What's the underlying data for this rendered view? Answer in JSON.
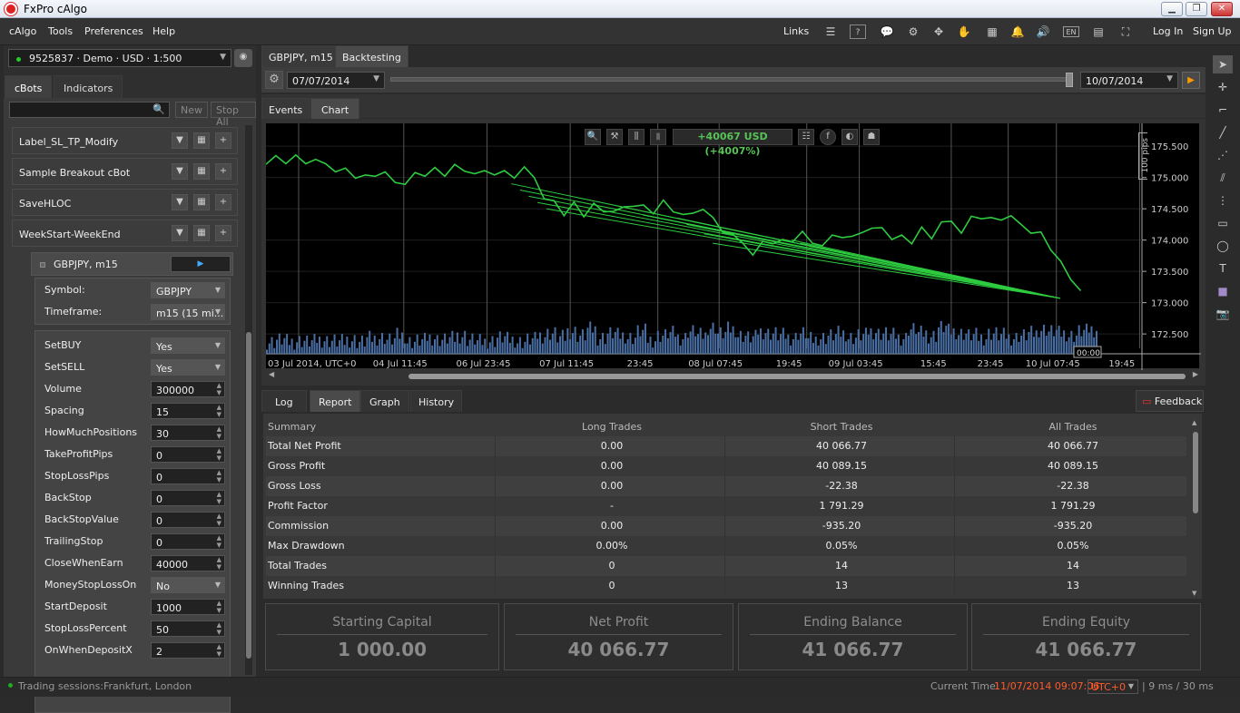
{
  "window": {
    "title": "FxPro cAlgo",
    "buttons": [
      "▁",
      "❐",
      "✕"
    ]
  },
  "menu": {
    "items": [
      "cAlgo",
      "Tools",
      "Preferences",
      "Help"
    ],
    "right": {
      "links": "Links",
      "login": "Log In",
      "signup": "Sign Up"
    },
    "icons": [
      "document-icon",
      "keyboard-shortcuts-icon",
      "chat-icon",
      "hub-icon",
      "settings-icon",
      "hand-check-icon",
      "calendar-icon",
      "bell-icon",
      "sound-icon",
      "language-icon",
      "layout-icon",
      "fullscreen-icon"
    ],
    "icon_glyphs": [
      "☰",
      "?",
      "💬",
      "⚙",
      "✥",
      "✋",
      "▦",
      "🔔",
      "🔊",
      "EN",
      "▤",
      "⛶"
    ]
  },
  "account": {
    "label": "9525837 · Demo · USD · 1:500",
    "status_color": "#22cc22"
  },
  "left_tabs": {
    "cbots": "cBots",
    "indicators": "Indicators"
  },
  "left_search": {
    "placeholder": "",
    "new": "New",
    "stop_all": "Stop All"
  },
  "bots": [
    {
      "name": "Label_SL_TP_Modify"
    },
    {
      "name": "Sample Breakout cBot"
    },
    {
      "name": "SaveHLOC"
    },
    {
      "name": "WeekStart-WeekEnd"
    }
  ],
  "instance": {
    "label": "GBPJPY, m15",
    "symbol": {
      "label": "Symbol:",
      "value": "GBPJPY"
    },
    "timeframe": {
      "label": "Timeframe:",
      "value": "m15 (15 mi..."
    },
    "params": [
      {
        "label": "SetBUY",
        "value": "Yes",
        "kind": "select"
      },
      {
        "label": "SetSELL",
        "value": "Yes",
        "kind": "select"
      },
      {
        "label": "Volume",
        "value": "300000",
        "kind": "num"
      },
      {
        "label": "Spacing",
        "value": "15",
        "kind": "num"
      },
      {
        "label": "HowMuchPositions",
        "value": "30",
        "kind": "num"
      },
      {
        "label": "TakeProfitPips",
        "value": "0",
        "kind": "num"
      },
      {
        "label": "StopLossPips",
        "value": "0",
        "kind": "num"
      },
      {
        "label": "BackStop",
        "value": "0",
        "kind": "num"
      },
      {
        "label": "BackStopValue",
        "value": "0",
        "kind": "num"
      },
      {
        "label": "TrailingStop",
        "value": "0",
        "kind": "num"
      },
      {
        "label": "CloseWhenEarn",
        "value": "40000",
        "kind": "num"
      },
      {
        "label": "MoneyStopLossOn",
        "value": "No",
        "kind": "select"
      },
      {
        "label": "StartDeposit",
        "value": "1000",
        "kind": "num"
      },
      {
        "label": "StopLossPercent",
        "value": "50",
        "kind": "num"
      },
      {
        "label": "OnWhenDepositX",
        "value": "2",
        "kind": "num"
      }
    ]
  },
  "center_tabs": {
    "symbol": "GBPJPY, m15",
    "backtesting": "Backtesting"
  },
  "backtest": {
    "from": "07/07/2014",
    "to": "10/07/2014"
  },
  "view_tabs": {
    "events": "Events",
    "chart": "Chart"
  },
  "chart_toolbar": {
    "profit": "+40067 USD (+4007%)"
  },
  "chart_data": {
    "type": "line",
    "symbol": "GBPJPY",
    "timeframe": "m15",
    "title": "",
    "ylabel": "",
    "pips_label": "100 pips",
    "y_ticks": [
      "175.500",
      "175.000",
      "174.500",
      "174.000",
      "173.500",
      "173.000",
      "172.500"
    ],
    "y_values": [
      175.5,
      175.0,
      174.5,
      174.0,
      173.5,
      173.0,
      172.5
    ],
    "ylim": [
      172.27,
      175.72
    ],
    "x_tick_labels": [
      "03 Jul 2014, UTC+0",
      "04 Jul 11:45",
      "06 Jul 23:45",
      "07 Jul 11:45",
      "23:45",
      "08 Jul 07:45",
      "19:45",
      "09 Jul 03:45",
      "15:45",
      "23:45",
      "10 Jul 07:45",
      "19:45"
    ],
    "x_positions": [
      0,
      0.12,
      0.215,
      0.31,
      0.41,
      0.48,
      0.58,
      0.64,
      0.745,
      0.81,
      0.865,
      0.96
    ],
    "cursor_time": "00:00",
    "price_series": [
      175.3,
      175.32,
      175.28,
      175.3,
      175.25,
      175.2,
      175.22,
      175.18,
      175.12,
      175.05,
      174.98,
      175.05,
      175.0,
      174.92,
      174.98,
      175.05,
      175.08,
      175.1,
      175.05,
      175.12,
      175.1,
      175.15,
      175.08,
      175.1,
      175.05,
      175.02,
      175.08,
      175.0,
      174.75,
      174.6,
      174.45,
      174.55,
      174.4,
      174.5,
      174.45,
      174.55,
      174.5,
      174.6,
      174.5,
      174.45,
      174.55,
      174.45,
      174.5,
      174.4,
      174.55,
      174.3,
      174.15,
      174.0,
      173.95,
      173.85,
      173.95,
      174.0,
      173.95,
      174.0,
      174.05,
      173.95,
      174.0,
      174.05,
      174.1,
      174.0,
      174.15,
      174.1,
      174.2,
      174.1,
      174.05,
      174.0,
      174.15,
      174.05,
      174.2,
      174.3,
      174.2,
      174.35,
      174.4,
      174.3,
      174.35,
      174.3,
      174.25,
      174.2,
      174.1,
      173.9,
      173.6,
      173.4,
      173.1
    ],
    "volume_series": [
      0.2,
      0.3,
      0.2,
      0.25,
      0.2,
      0.3,
      0.25,
      0.2,
      0.3,
      0.2,
      0.35,
      0.4,
      0.3,
      0.5,
      0.2,
      0.25,
      0.4,
      0.3,
      0.35,
      0.5,
      0.3,
      0.2,
      0.25,
      0.4,
      0.3,
      0.2,
      0.3,
      0.5,
      0.6,
      0.4,
      0.7,
      0.5,
      0.8,
      0.4,
      0.6,
      0.5,
      0.4,
      0.7,
      0.3,
      0.5,
      0.6,
      0.4,
      0.7,
      0.5,
      0.9,
      0.6,
      0.8,
      0.5,
      0.4,
      0.7,
      0.6,
      0.5,
      0.4,
      0.6,
      0.3,
      0.4,
      0.5,
      0.6,
      0.4,
      0.5,
      0.7,
      0.6,
      0.5,
      0.4,
      0.8,
      0.6,
      0.5,
      0.9,
      0.7,
      0.6,
      0.5,
      0.4,
      0.6,
      0.5,
      0.4,
      0.5,
      0.6,
      0.8,
      0.7,
      0.6,
      0.5,
      0.7,
      0.8
    ],
    "trade_lines": [
      {
        "from_x": 0.28,
        "from_y": 174.9
      },
      {
        "from_x": 0.3,
        "from_y": 174.7
      },
      {
        "from_x": 0.31,
        "from_y": 174.6
      },
      {
        "from_x": 0.32,
        "from_y": 174.5
      },
      {
        "from_x": 0.4,
        "from_y": 174.55
      },
      {
        "from_x": 0.43,
        "from_y": 174.4
      },
      {
        "from_x": 0.47,
        "from_y": 174.35
      },
      {
        "from_x": 0.48,
        "from_y": 174.25
      },
      {
        "from_x": 0.5,
        "from_y": 174.1
      },
      {
        "from_x": 0.51,
        "from_y": 173.95
      },
      {
        "from_x": 0.6,
        "from_y": 174.0
      },
      {
        "from_x": 0.61,
        "from_y": 173.95
      },
      {
        "from_x": 0.62,
        "from_y": 173.9
      },
      {
        "from_x": 0.29,
        "from_y": 174.8
      }
    ],
    "trade_end": {
      "x": 0.88,
      "y": 173.07
    },
    "line_color": "#2ecc40"
  },
  "bottom_tabs": {
    "log": "Log",
    "report": "Report",
    "graph": "Graph",
    "history": "History",
    "feedback": "Feedback"
  },
  "report": {
    "headers": [
      "Summary",
      "Long Trades",
      "Short Trades",
      "All Trades"
    ],
    "rows": [
      [
        "Total Net Profit",
        "0.00",
        "40 066.77",
        "40 066.77"
      ],
      [
        "Gross Profit",
        "0.00",
        "40 089.15",
        "40 089.15"
      ],
      [
        "Gross Loss",
        "0.00",
        "-22.38",
        "-22.38"
      ],
      [
        "Profit Factor",
        "-",
        "1 791.29",
        "1 791.29"
      ],
      [
        "Commission",
        "0.00",
        "-935.20",
        "-935.20"
      ],
      [
        "Max Drawdown",
        "0.00%",
        "0.05%",
        "0.05%"
      ],
      [
        "Total Trades",
        "0",
        "14",
        "14"
      ],
      [
        "Winning Trades",
        "0",
        "13",
        "13"
      ]
    ]
  },
  "summary_cards": [
    {
      "title": "Starting Capital",
      "value": "1 000.00"
    },
    {
      "title": "Net Profit",
      "value": "40 066.77"
    },
    {
      "title": "Ending Balance",
      "value": "41 066.77"
    },
    {
      "title": "Ending Equity",
      "value": "41 066.77"
    }
  ],
  "right_tools": [
    "cursor-icon",
    "crosshair-icon",
    "measure-icon",
    "trend-line-icon",
    "fibonacci-icon",
    "pitchfork-icon",
    "grid-icon",
    "rectangle-icon",
    "ellipse-icon",
    "text-icon",
    "color-swatch-icon",
    "camera-icon"
  ],
  "right_tool_glyphs": [
    "➤",
    "✛",
    "⌐",
    "╱",
    "⋰",
    "⫽",
    "⋮",
    "▭",
    "◯",
    "T",
    "■",
    "📷"
  ],
  "status": {
    "sessions_label": "Trading sessions:",
    "sessions": "Frankfurt, London",
    "current_time_label": "Current Time:",
    "current_time": "11/07/2014 09:07:06",
    "timezone": "UTC+0",
    "latency": "| 9 ms / 30 ms",
    "time_color": "#ff5a2a"
  }
}
